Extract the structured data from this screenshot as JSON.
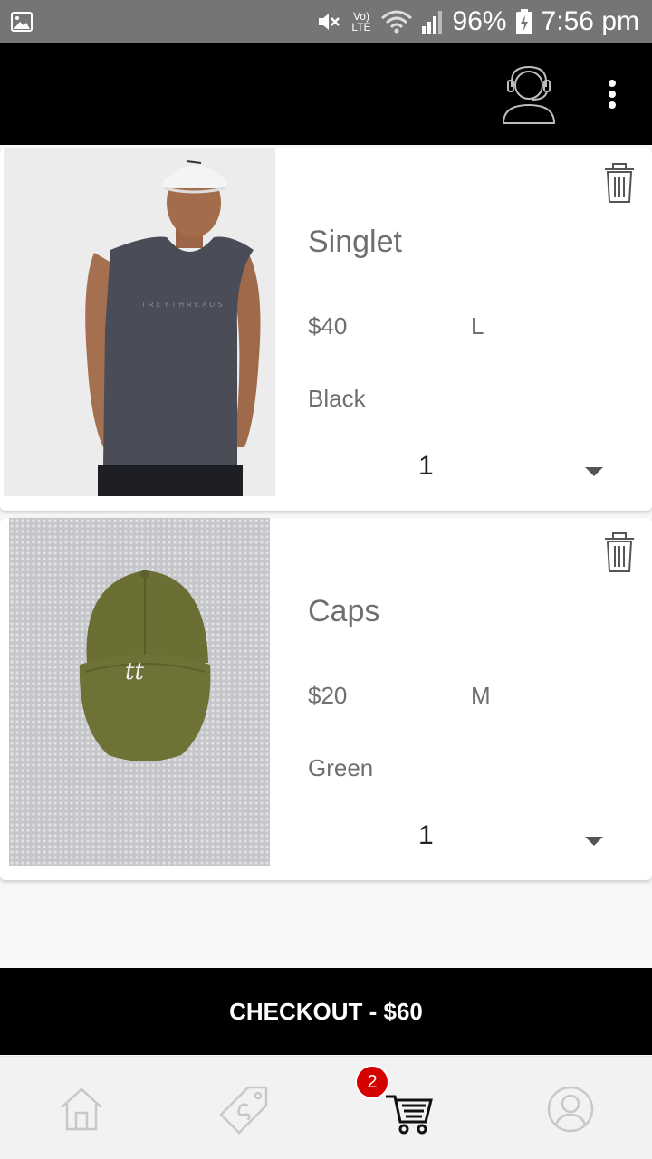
{
  "status_bar": {
    "battery": "96%",
    "time": "7:56 pm",
    "network_label": "LTE",
    "icons": [
      "image-icon",
      "mute-icon",
      "volte-icon",
      "wifi-icon",
      "signal-icon",
      "battery-charging-icon"
    ]
  },
  "app_bar": {
    "icons": [
      "support-agent-icon",
      "more-vertical-icon"
    ]
  },
  "cart": {
    "items": [
      {
        "name": "Singlet",
        "price": "$40",
        "size": "L",
        "color": "Black",
        "quantity": "1",
        "image": "man-in-grey-singlet-photo",
        "print": "TREYTHREADS"
      },
      {
        "name": "Caps",
        "price": "$20",
        "size": "M",
        "color": "Green",
        "quantity": "1",
        "image": "olive-cap-photo",
        "print": "tt"
      }
    ]
  },
  "checkout": {
    "label": "CHECKOUT - $60"
  },
  "bottom_nav": {
    "items": [
      "home-icon",
      "tag-icon",
      "cart-icon",
      "profile-icon"
    ],
    "cart_badge": "2",
    "accent": "#d50000"
  }
}
